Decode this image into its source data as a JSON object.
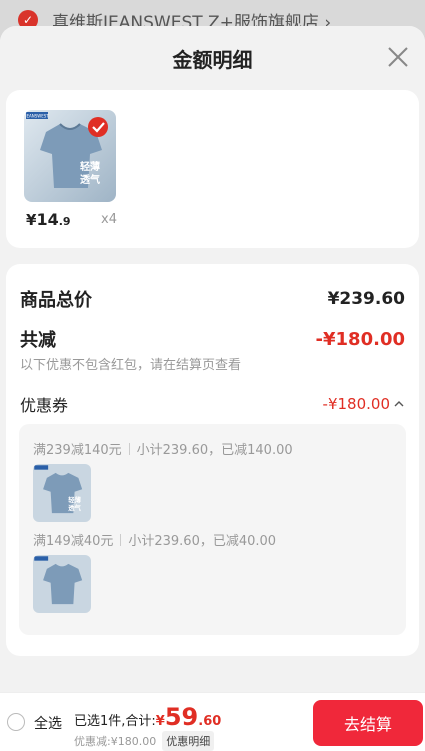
{
  "background": {
    "shop_name": "真维斯JEANSWEST Z+服饰旗舰店 ›"
  },
  "sheet": {
    "title": "金额明细"
  },
  "product": {
    "price_symbol": "¥",
    "price_int": "14",
    "price_dec": ".9",
    "quantity": "x4",
    "image_brand_text": "JEANSWEST",
    "image_slogan_line1": "轻薄",
    "image_slogan_line2": "透气",
    "selected": true
  },
  "summary": {
    "total_label": "商品总价",
    "total_value": "¥239.60",
    "reduce_label": "共减",
    "reduce_value": "-¥180.00",
    "reduce_note": "以下优惠不包含红包，请在结算页查看",
    "coupon_label": "优惠券",
    "coupon_value": "-¥180.00",
    "coupons": [
      {
        "rule": "满239减140元",
        "detail": "小计239.60，已减140.00"
      },
      {
        "rule": "满149减40元",
        "detail": "小计239.60，已减40.00"
      }
    ]
  },
  "bottom_bar": {
    "select_all": "全选",
    "selected_text": "已选1件,合计:",
    "total_symbol": "¥",
    "total_int": "59",
    "total_dec": ".60",
    "discount_text": "优惠减:¥180.00",
    "detail_button": "优惠明细",
    "checkout_button": "去结算"
  },
  "colors": {
    "accent_red": "#e02e24",
    "checkout_red": "#f0283a",
    "shirt_blue": "#7d9bb8"
  }
}
